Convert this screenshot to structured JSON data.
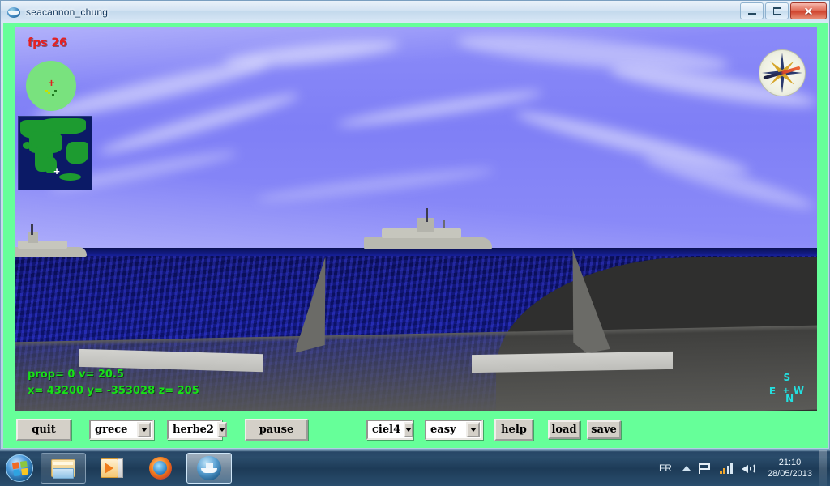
{
  "window": {
    "title": "seacannon_chung",
    "icon": "ship-globe-icon",
    "buttons": {
      "minimize": "minimize-icon",
      "maximize": "maximize-icon",
      "close": "close-icon"
    }
  },
  "hud": {
    "fps": "fps 26",
    "stats_line1": "prop= 0  v= 20.5",
    "stats_line2": "x= 43200  y= -353028  z= 205",
    "compass": {
      "north": "N",
      "south": "S",
      "east": "E",
      "west": "W",
      "center": "+"
    },
    "radar_marker": "+",
    "minimap_marker": "+"
  },
  "controls": {
    "quit_label": "quit",
    "terrain_select": "grece",
    "texture_select": "herbe2",
    "pause_label": "pause",
    "sky_select": "ciel4",
    "difficulty_select": "easy",
    "help_label": "help",
    "load_label": "load",
    "save_label": "save"
  },
  "taskbar": {
    "start": "windows-start-orb",
    "items": [
      {
        "name": "file-explorer",
        "label": "Windows Explorer"
      },
      {
        "name": "media-player",
        "label": "Windows Media Player"
      },
      {
        "name": "firefox",
        "label": "Mozilla Firefox"
      },
      {
        "name": "seacannon-app",
        "label": "seacannon_chung"
      }
    ],
    "tray": {
      "language": "FR",
      "time": "21:10",
      "date": "28/05/2013"
    }
  },
  "colors": {
    "applet_background": "#66ff99",
    "sky": "#7f7ff6",
    "sea": "#14209a",
    "deck": "#5a5a57",
    "hud_green": "#18e018",
    "hud_red": "#e8201f",
    "hud_cyan": "#23e0e0"
  }
}
